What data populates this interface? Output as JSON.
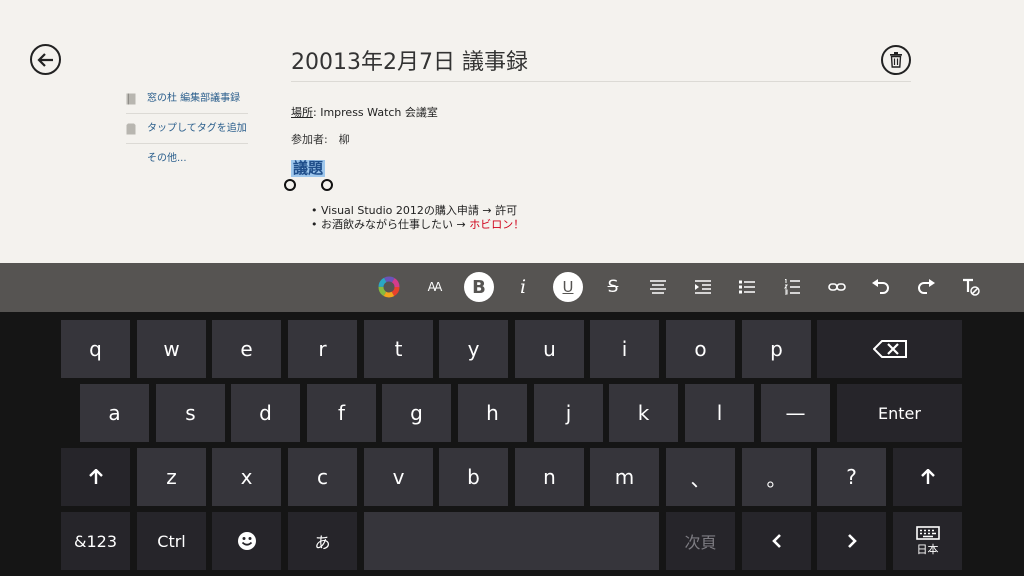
{
  "note": {
    "title": "20013年2月7日 議事録",
    "sidebar": {
      "notebook": "窓の杜 編集部議事録",
      "add_tag": "タップしてタグを追加",
      "more": "その他..."
    },
    "location_label": "場所",
    "location_value": ": Impress Watch 会議室",
    "participants": "参加者:　柳",
    "agenda_heading": "議題",
    "agenda_items": [
      {
        "text": "Visual Studio 2012の購入申請 → 許可",
        "highlight": ""
      },
      {
        "text": "お酒飲みながら仕事したい → ",
        "highlight": "ホビロン！"
      }
    ]
  },
  "toolbar": {
    "buttons": [
      "color",
      "font-size",
      "bold",
      "italic",
      "underline",
      "strikethrough",
      "align",
      "indent",
      "bulleted-list",
      "numbered-list",
      "link",
      "undo",
      "redo",
      "clear-format"
    ],
    "active": [
      "bold",
      "underline"
    ],
    "labels": {
      "font_size": "AA",
      "bold": "B",
      "italic": "i",
      "underline": "U",
      "strike": "S"
    }
  },
  "keyboard": {
    "row1": [
      "q",
      "w",
      "e",
      "r",
      "t",
      "y",
      "u",
      "i",
      "o",
      "p"
    ],
    "row2": [
      "a",
      "s",
      "d",
      "f",
      "g",
      "h",
      "j",
      "k",
      "l",
      "—"
    ],
    "row3": [
      "z",
      "x",
      "c",
      "v",
      "b",
      "n",
      "m",
      "、",
      "。",
      "?"
    ],
    "enter": "Enter",
    "sym": "&123",
    "ctrl": "Ctrl",
    "kana": "あ",
    "next_candidate": "次頁",
    "layout_label": "日本"
  },
  "colors": {
    "background": "#f4f2ee",
    "toolbar": "#565452",
    "key": "#36353b",
    "key_dark": "#26252a",
    "keyboard_bg": "#151515",
    "link": "#2a5e8c",
    "highlight": "#9ec7ec",
    "red": "#d0021b"
  }
}
